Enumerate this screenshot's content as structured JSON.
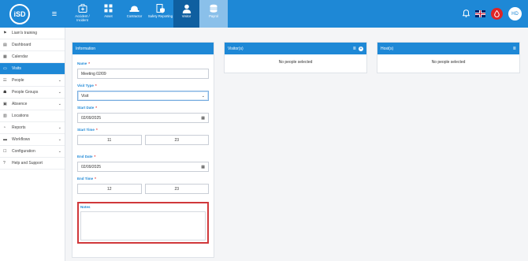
{
  "header": {
    "logo_text": "iSD",
    "nav": [
      {
        "label": "Accident / Incident",
        "icon": "first-aid-kit-icon"
      },
      {
        "label": "Asset",
        "icon": "grid-icon"
      },
      {
        "label": "Contractor",
        "icon": "hard-hat-icon"
      },
      {
        "label": "Safety Reporting",
        "icon": "report-shield-icon"
      },
      {
        "label": "Visitor",
        "icon": "person-icon"
      },
      {
        "label": "Payrol",
        "icon": "coins-icon"
      }
    ],
    "active_nav": "Visitor",
    "avatar_initials": "HD",
    "colors": {
      "brand": "#1e88d6",
      "active_tab": "#0f5fa0",
      "alert": "#e02424"
    }
  },
  "sidebar": {
    "items": [
      {
        "label": "Liam's training",
        "icon": "training-icon",
        "chevron": false
      },
      {
        "label": "Dashboard",
        "icon": "dashboard-icon",
        "chevron": false
      },
      {
        "label": "Calendar",
        "icon": "calendar-icon",
        "chevron": false
      },
      {
        "label": "Visits",
        "icon": "visits-icon",
        "chevron": false
      },
      {
        "label": "People",
        "icon": "people-icon",
        "chevron": true
      },
      {
        "label": "People Groups",
        "icon": "people-groups-icon",
        "chevron": true
      },
      {
        "label": "Absence",
        "icon": "absence-icon",
        "chevron": true
      },
      {
        "label": "Locations",
        "icon": "location-icon",
        "chevron": false
      },
      {
        "label": "Reports",
        "icon": "reports-icon",
        "chevron": true
      },
      {
        "label": "Workflows",
        "icon": "workflows-icon",
        "chevron": true
      },
      {
        "label": "Configuration",
        "icon": "configuration-icon",
        "chevron": true
      },
      {
        "label": "Help and Support",
        "icon": "help-icon",
        "chevron": false
      }
    ],
    "active": "Visits"
  },
  "info_panel": {
    "title": "Information",
    "name_label": "Name",
    "name_value": "Meeting 02/09",
    "visit_type_label": "Visit Type",
    "visit_type_value": "Visit",
    "start_date_label": "Start Date",
    "start_date_value": "02/09/2025",
    "start_time_label": "Start Time",
    "start_hour": "11",
    "start_minute": "23",
    "end_date_label": "End Date",
    "end_date_value": "02/09/2025",
    "end_time_label": "End Time",
    "end_hour": "12",
    "end_minute": "23",
    "notes_label": "Notes",
    "required_mark": "*"
  },
  "visitors_panel": {
    "title": "Visitor(s)",
    "empty": "No people selected"
  },
  "hosts_panel": {
    "title": "Host(s)",
    "empty": "No people selected"
  }
}
